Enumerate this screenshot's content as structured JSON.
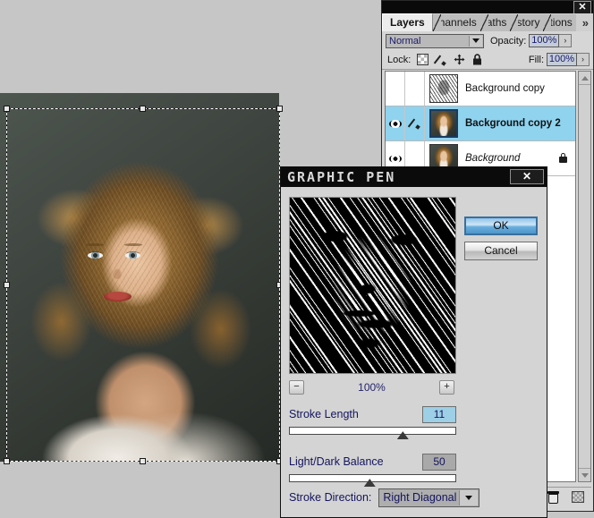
{
  "document_window": {
    "name": "image-canvas",
    "selection_handles": 8,
    "subject": "portrait photo of woman with curly blonde hair"
  },
  "layers_palette": {
    "close_label": "✕",
    "tabs": [
      {
        "label": "Layers",
        "active": true
      },
      {
        "label": "hannels",
        "active": false
      },
      {
        "label": "aths",
        "active": false
      },
      {
        "label": "story",
        "active": false
      },
      {
        "label": "tions",
        "active": false
      }
    ],
    "overflow_label": "»",
    "blend_mode": "Normal",
    "opacity_label": "Opacity:",
    "opacity_value": "100%",
    "opacity_spin": "›",
    "lock_label": "Lock:",
    "lock_icons": [
      "transparency-lock-icon",
      "paint-lock-icon",
      "move-lock-icon",
      "all-lock-icon"
    ],
    "fill_label": "Fill:",
    "fill_value": "100%",
    "fill_spin": "›",
    "layers": [
      {
        "name": "Background copy",
        "visible": false,
        "linked_brush": false,
        "selected": false,
        "locked": false,
        "thumb": "sketch",
        "style": "normal"
      },
      {
        "name": "Background copy 2",
        "visible": true,
        "linked_brush": true,
        "selected": true,
        "locked": false,
        "thumb": "photo",
        "style": "bold"
      },
      {
        "name": "Background",
        "visible": true,
        "linked_brush": false,
        "selected": false,
        "locked": true,
        "thumb": "photo",
        "style": "italic"
      }
    ]
  },
  "graphic_pen_dialog": {
    "title": "GRAPHIC PEN",
    "close_label": "✕",
    "ok_label": "OK",
    "cancel_label": "Cancel",
    "zoom_out_label": "−",
    "zoom_in_label": "+",
    "zoom_value": "100%",
    "stroke_length": {
      "label": "Stroke Length",
      "value": "11",
      "thumb_percent": 68,
      "focused": true
    },
    "light_dark_balance": {
      "label": "Light/Dark Balance",
      "value": "50",
      "thumb_percent": 48,
      "focused": false
    },
    "stroke_direction": {
      "label": "Stroke Direction:",
      "value": "Right Diagonal"
    }
  },
  "colors": {
    "selection_blue": "#8fd3ef",
    "dialog_bg": "#d4d4d4",
    "label_navy": "#14145e",
    "titlebar_black": "#0b0b0b"
  }
}
